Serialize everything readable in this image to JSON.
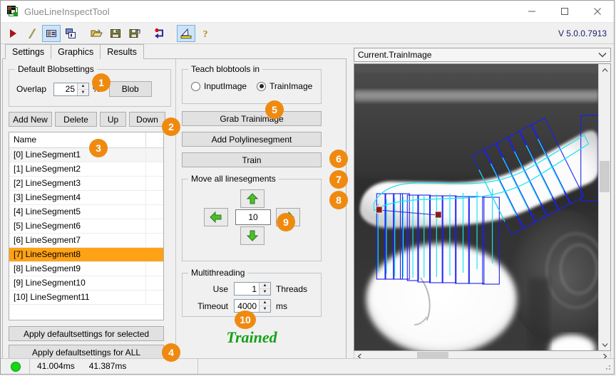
{
  "window": {
    "title": "GlueLineInspectTool",
    "minimize": "–",
    "maximize": "□",
    "close": "✕",
    "version": "V 5.0.0.7913"
  },
  "toolbar": {
    "items": [
      {
        "name": "run-icon",
        "tip": "Run"
      },
      {
        "name": "lightning-icon",
        "tip": "Quick"
      },
      {
        "name": "card-view-icon",
        "tip": "Card view"
      },
      {
        "name": "copy-card-icon",
        "tip": "Copy card"
      },
      {
        "name": "open-folder-icon",
        "tip": "Open"
      },
      {
        "name": "save-icon",
        "tip": "Save"
      },
      {
        "name": "save-as-icon",
        "tip": "Save as"
      },
      {
        "name": "load-record-icon",
        "tip": "Load record"
      },
      {
        "name": "measure-icon",
        "tip": "Measure"
      },
      {
        "name": "help-icon",
        "tip": "Help"
      }
    ]
  },
  "tabs": [
    {
      "label": "Settings",
      "active": true
    },
    {
      "label": "Graphics",
      "active": false
    },
    {
      "label": "Results",
      "active": false
    }
  ],
  "settings": {
    "default_blobsettings": {
      "legend": "Default Blobsettings",
      "overlap_label": "Overlap",
      "overlap_value": "25",
      "percent_unit": "%",
      "blob_button": "Blob"
    },
    "list_actions": [
      "Add New",
      "Delete",
      "Up",
      "Down"
    ],
    "list": {
      "header": "Name",
      "rows": [
        {
          "text": "[0] LineSegment1",
          "selected": false,
          "hover": true
        },
        {
          "text": "[1] LineSegment2",
          "selected": false,
          "hover": false
        },
        {
          "text": "[2] LineSegment3",
          "selected": false,
          "hover": false
        },
        {
          "text": "[3] LineSegment4",
          "selected": false,
          "hover": false
        },
        {
          "text": "[4] LineSegment5",
          "selected": false,
          "hover": false
        },
        {
          "text": "[5] LineSegment6",
          "selected": false,
          "hover": false
        },
        {
          "text": "[6] LineSegment7",
          "selected": false,
          "hover": false
        },
        {
          "text": "[7] LineSegment8",
          "selected": true,
          "hover": false
        },
        {
          "text": "[8] LineSegment9",
          "selected": false,
          "hover": false
        },
        {
          "text": "[9] LineSegment10",
          "selected": false,
          "hover": false
        },
        {
          "text": "[10] LineSegment11",
          "selected": false,
          "hover": false
        }
      ]
    },
    "apply_selected": "Apply defaultsettings for selected",
    "apply_all": "Apply defaultsettings for ALL",
    "teach": {
      "legend": "Teach blobtools in",
      "options": [
        {
          "label": "InputImage",
          "checked": false
        },
        {
          "label": "TrainImage",
          "checked": true
        }
      ]
    },
    "actions": {
      "grab": "Grab Trainimage",
      "add_poly": "Add Polylinesegment",
      "train": "Train"
    },
    "move": {
      "legend": "Move all linesegments",
      "step_value": "10",
      "up": "▲",
      "down": "▼",
      "left": "◀",
      "right": "▶"
    },
    "multithreading": {
      "legend": "Multithreading",
      "use_label": "Use",
      "threads_value": "1",
      "threads_unit": "Threads",
      "timeout_label": "Timeout",
      "timeout_value": "4000",
      "timeout_unit": "ms"
    },
    "state_text": "Trained"
  },
  "callouts": [
    "1",
    "2",
    "3",
    "4",
    "5",
    "6",
    "7",
    "8",
    "9",
    "10"
  ],
  "viewer": {
    "source_selected": "Current.TrainImage",
    "scroll_up": "⌃",
    "scroll_down": "⌄",
    "scroll_left": "‹",
    "scroll_right": "›"
  },
  "statusbar": {
    "led_color": "#14d814",
    "time_1": "41.004ms",
    "time_2": "41.387ms"
  },
  "colors": {
    "accent": "#ef8a10",
    "selection": "#ffa216",
    "trained_green": "#14a114",
    "version_blue": "#1a1a6e",
    "overlay_blue": "#1a20f0",
    "overlay_cyan": "#19e3f5"
  }
}
